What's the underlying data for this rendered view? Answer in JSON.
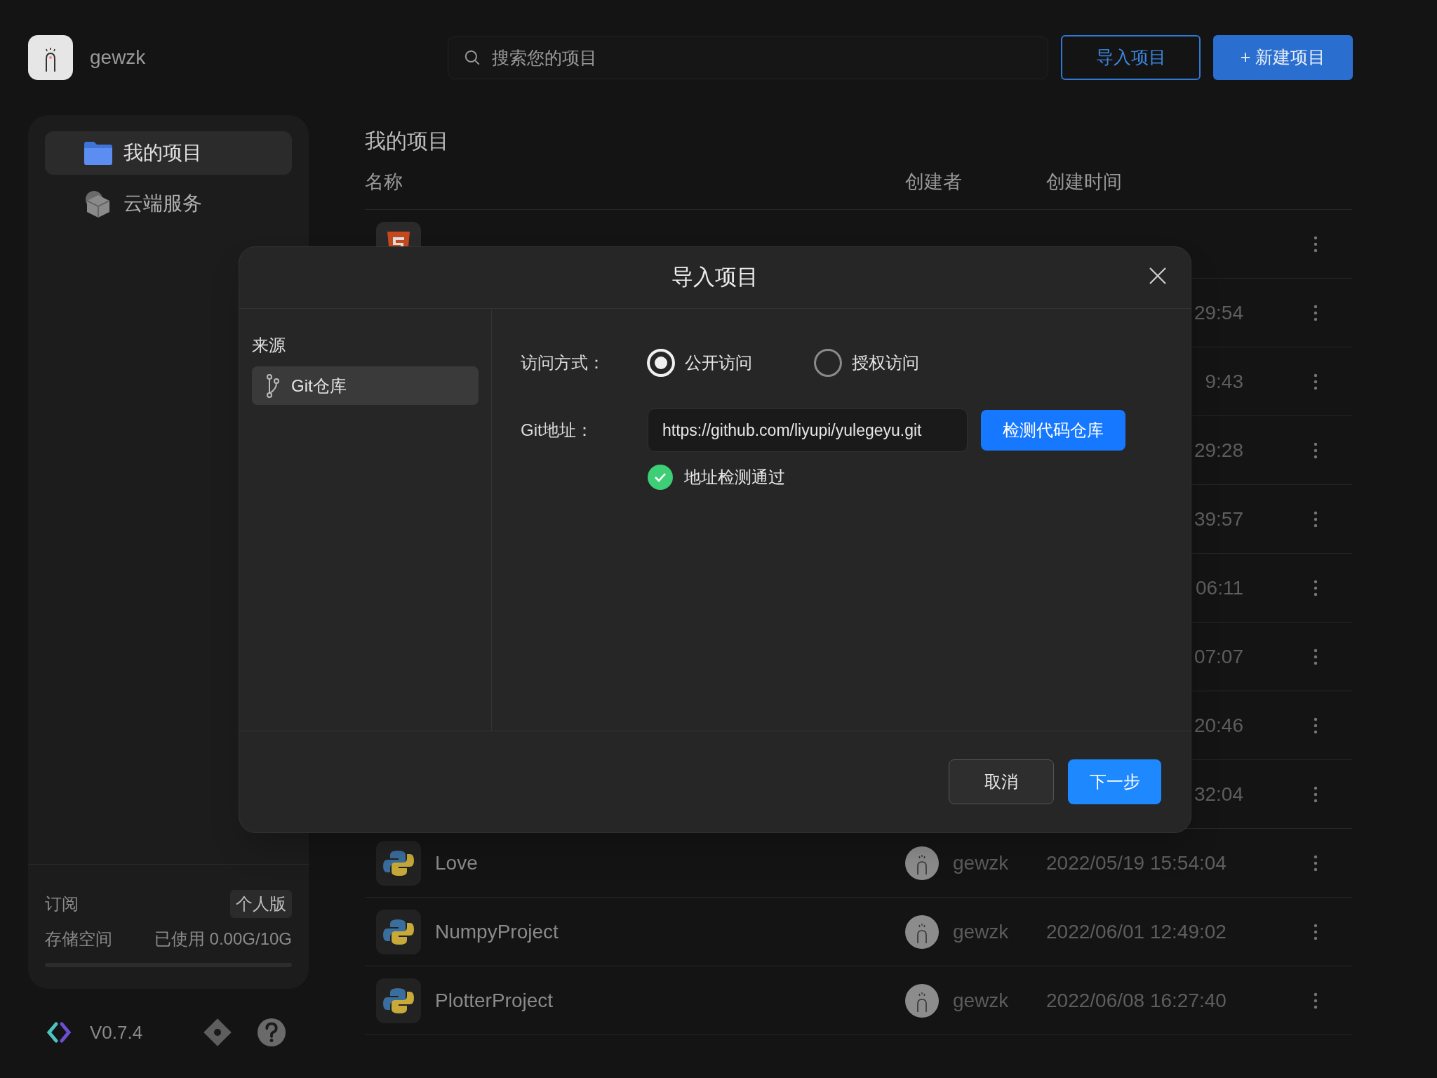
{
  "user": {
    "name": "gewzk"
  },
  "search": {
    "placeholder": "搜索您的项目"
  },
  "header_buttons": [
    {
      "label": "导入项目",
      "kind": "outline"
    },
    {
      "label": "+ 新建项目",
      "kind": "primary"
    }
  ],
  "sidebar": {
    "items": [
      {
        "label": "我的项目",
        "kind": "folder",
        "selected": true
      },
      {
        "label": "云端服务",
        "kind": "cube",
        "selected": false
      }
    ],
    "subscription": {
      "label": "订阅",
      "plan": "个人版"
    },
    "storage": {
      "label": "存储空间",
      "usage": "已使用 0.00G/10G",
      "level": 0
    }
  },
  "footer": {
    "version": "V0.7.4"
  },
  "projects": {
    "title": "我的项目",
    "columns": [
      "名称",
      "创建者",
      "创建时间"
    ],
    "rows": [
      {
        "kind": "html"
      },
      {
        "time": "29:54"
      },
      {
        "time": "9:43"
      },
      {
        "time": "29:28"
      },
      {
        "time": "39:57"
      },
      {
        "time": "06:11"
      },
      {
        "time": "07:07"
      },
      {
        "time": "20:46"
      },
      {
        "time": "32:04"
      },
      {
        "kind": "python",
        "name": "Love",
        "creator": "gewzk",
        "time": "2022/05/19 15:54:04"
      },
      {
        "kind": "python",
        "name": "NumpyProject",
        "creator": "gewzk",
        "time": "2022/06/01 12:49:02"
      },
      {
        "kind": "python",
        "name": "PlotterProject",
        "creator": "gewzk",
        "time": "2022/06/08 16:27:40"
      }
    ]
  },
  "dialog": {
    "title": "导入项目",
    "source_label": "来源",
    "sources": [
      {
        "label": "Git仓库",
        "selected": true
      }
    ],
    "access": {
      "label": "访问方式：",
      "options": [
        {
          "label": "公开访问",
          "selected": true
        },
        {
          "label": "授权访问",
          "selected": false
        }
      ]
    },
    "git": {
      "label": "Git地址：",
      "value": "https://github.com/liyupi/yulegeyu.git",
      "button": "检测代码仓库"
    },
    "status": {
      "text": "地址检测通过",
      "ok": true
    },
    "buttons": [
      {
        "label": "取消",
        "kind": "secondary"
      },
      {
        "label": "下一步",
        "kind": "primary"
      }
    ]
  }
}
